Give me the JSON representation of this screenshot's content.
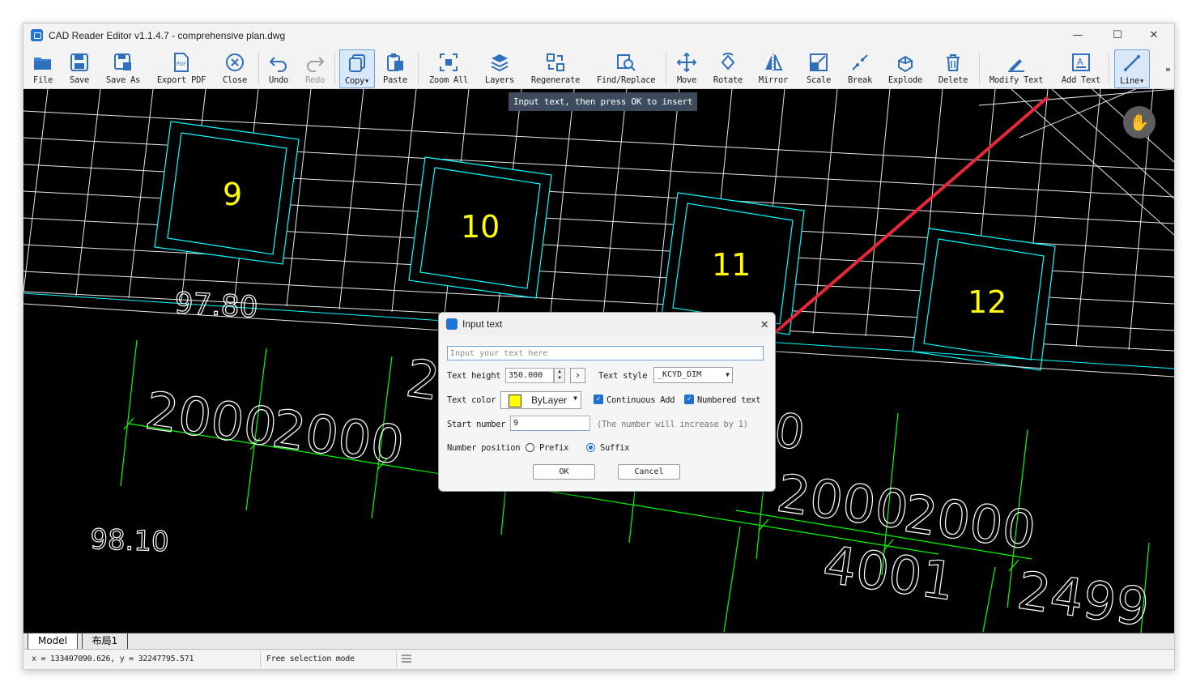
{
  "window": {
    "title": "CAD Reader Editor v1.1.4.7 - comprehensive plan.dwg",
    "controls": [
      "—",
      "☐",
      "✕"
    ]
  },
  "toolbar": {
    "items": [
      {
        "label": "File",
        "icon": "folder-icon"
      },
      {
        "label": "Save",
        "icon": "save-icon"
      },
      {
        "label": "Save As",
        "icon": "save-as-icon"
      },
      {
        "label": "Export PDF",
        "icon": "pdf-icon"
      },
      {
        "label": "Close",
        "icon": "close-circle-icon"
      },
      {
        "label": "Undo",
        "icon": "undo-icon"
      },
      {
        "label": "Redo",
        "icon": "redo-icon"
      },
      {
        "label": "Copy▾",
        "icon": "copy-icon"
      },
      {
        "label": "Paste",
        "icon": "paste-icon"
      },
      {
        "label": "Zoom All",
        "icon": "zoom-all-icon"
      },
      {
        "label": "Layers",
        "icon": "layers-icon"
      },
      {
        "label": "Regenerate",
        "icon": "regenerate-icon"
      },
      {
        "label": "Find/Replace",
        "icon": "find-icon"
      },
      {
        "label": "Move",
        "icon": "move-icon"
      },
      {
        "label": "Rotate",
        "icon": "rotate-icon"
      },
      {
        "label": "Mirror",
        "icon": "mirror-icon"
      },
      {
        "label": "Scale",
        "icon": "scale-icon"
      },
      {
        "label": "Break",
        "icon": "break-icon"
      },
      {
        "label": "Explode",
        "icon": "explode-icon"
      },
      {
        "label": "Delete",
        "icon": "trash-icon"
      },
      {
        "label": "Modify Text",
        "icon": "modify-text-icon"
      },
      {
        "label": "Add Text",
        "icon": "add-text-icon"
      },
      {
        "label": "Line▾",
        "icon": "line-icon"
      }
    ],
    "more": "»"
  },
  "tooltip": "Input text, then press OK to insert",
  "drawing": {
    "room_numbers": [
      "9",
      "10",
      "11",
      "12"
    ],
    "dimensions": [
      "97.80",
      "98.10",
      "2000",
      "2000",
      "2",
      "2000",
      "2000",
      "4001",
      "2499",
      "0"
    ]
  },
  "dialog": {
    "title": "Input text",
    "input_placeholder": "Input your text here",
    "text_height_label": "Text height",
    "text_height_value": "350.000",
    "text_style_label": "Text style",
    "text_style_value": "_KCYD_DIM",
    "text_color_label": "Text color",
    "text_color_value": "ByLayer",
    "swatch_color": "#ffff00",
    "continuous_add_label": "Continuous Add",
    "numbered_text_label": "Numbered text",
    "start_number_label": "Start number",
    "start_number_value": "9",
    "increase_note": "(The number will increase by 1)",
    "number_position_label": "Number position",
    "prefix_label": "Prefix",
    "suffix_label": "Suffix",
    "ok_label": "OK",
    "cancel_label": "Cancel"
  },
  "tabs": {
    "model": "Model",
    "layout": "布局1"
  },
  "status": {
    "coordinates": "x = 133407090.626, y = 32247795.571",
    "mode": "Free selection mode"
  },
  "colors": {
    "accent": "#1f6fd0",
    "cad_cyan": "#00ffff",
    "cad_green": "#00ff00",
    "cad_yellow": "#ffff00",
    "annotation_red": "#e8283a"
  }
}
